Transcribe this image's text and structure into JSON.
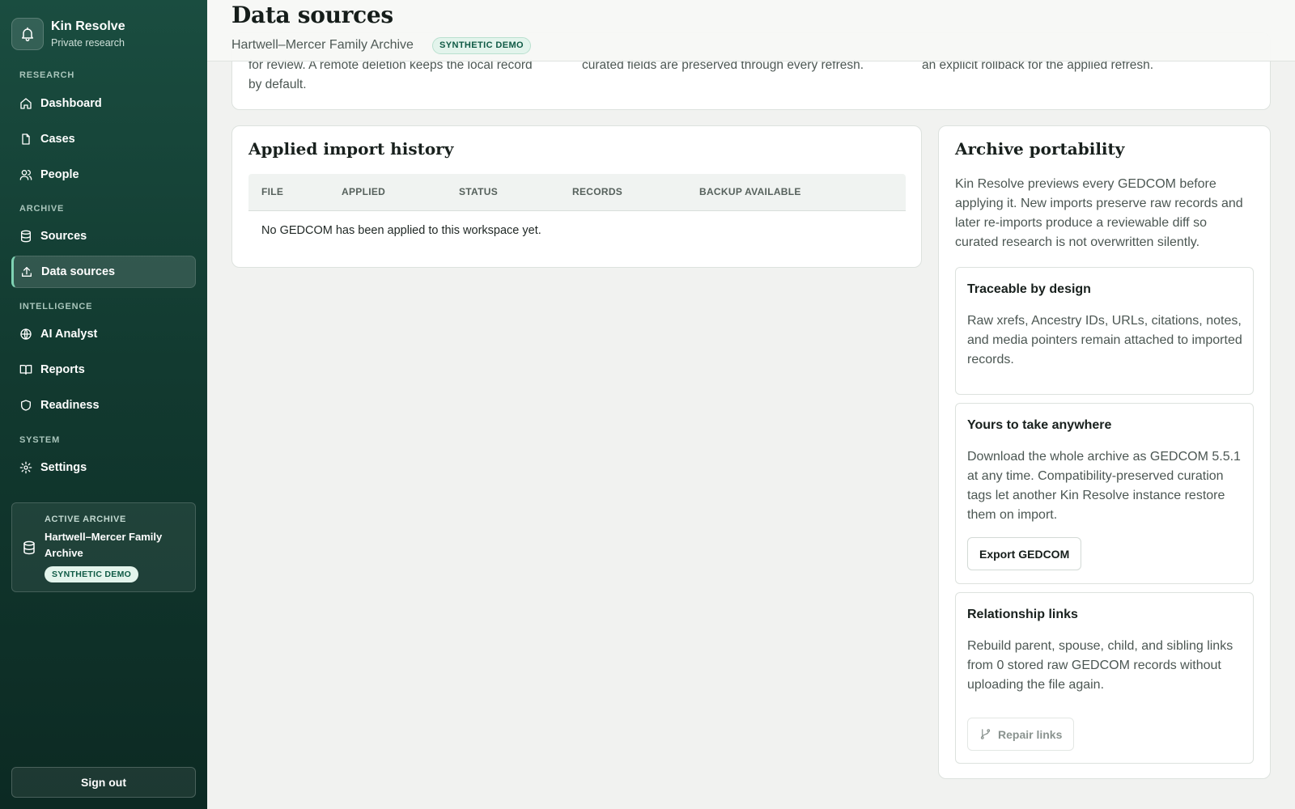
{
  "brand": {
    "name": "Kin Resolve",
    "subtitle": "Private research"
  },
  "sidebar": {
    "sections": [
      {
        "label": "RESEARCH"
      },
      {
        "label": "ARCHIVE"
      },
      {
        "label": "INTELLIGENCE"
      },
      {
        "label": "SYSTEM"
      }
    ],
    "items": [
      {
        "label": "Dashboard",
        "icon": "home-icon"
      },
      {
        "label": "Cases",
        "icon": "file-icon"
      },
      {
        "label": "People",
        "icon": "users-icon"
      },
      {
        "label": "Sources",
        "icon": "database-icon"
      },
      {
        "label": "Data sources",
        "icon": "upload-icon",
        "active": true
      },
      {
        "label": "AI Analyst",
        "icon": "globe-icon"
      },
      {
        "label": "Reports",
        "icon": "book-icon"
      },
      {
        "label": "Readiness",
        "icon": "shield-icon"
      },
      {
        "label": "Settings",
        "icon": "gear-icon"
      }
    ],
    "active_archive": {
      "label": "ACTIVE ARCHIVE",
      "name": "Hartwell–Mercer Family Archive",
      "badge": "SYNTHETIC DEMO"
    },
    "sign_out": "Sign out"
  },
  "header": {
    "title": "Data sources",
    "subtitle": "Hartwell–Mercer Family Archive",
    "badge": "SYNTHETIC DEMO"
  },
  "top_card": {
    "col1_line1": "for review. A remote deletion keeps the local record",
    "col1_line2": "by default.",
    "col2_line1": "curated fields are preserved through every refresh.",
    "col3_line1": "an explicit rollback for the applied refresh."
  },
  "history": {
    "title": "Applied import history",
    "columns": [
      "FILE",
      "APPLIED",
      "STATUS",
      "RECORDS",
      "BACKUP AVAILABLE"
    ],
    "empty_message": "No GEDCOM has been applied to this workspace yet."
  },
  "portability": {
    "title": "Archive portability",
    "intro": "Kin Resolve previews every GEDCOM before applying it. New imports preserve raw records and later re-imports produce a reviewable diff so curated research is not overwritten silently.",
    "features": [
      {
        "title": "Traceable by design",
        "body": "Raw xrefs, Ancestry IDs, URLs, citations, notes, and media pointers remain attached to imported records."
      },
      {
        "title": "Yours to take anywhere",
        "body": "Download the whole archive as GEDCOM 5.5.1 at any time. Compatibility-preserved curation tags let another Kin Resolve instance restore them on import.",
        "button": "Export GEDCOM"
      },
      {
        "title": "Relationship links",
        "body": "Rebuild parent, spouse, child, and sibling links from 0 stored raw GEDCOM records without uploading the file again.",
        "button": "Repair links",
        "button_icon": "git-branch-icon",
        "button_disabled": true
      }
    ]
  },
  "colors": {
    "sidebar_top": "#1a4d40",
    "sidebar_bottom": "#0c2a23",
    "accent": "#7fd2b3",
    "badge_bg": "#e3f4ec",
    "badge_text": "#0f5a45"
  }
}
